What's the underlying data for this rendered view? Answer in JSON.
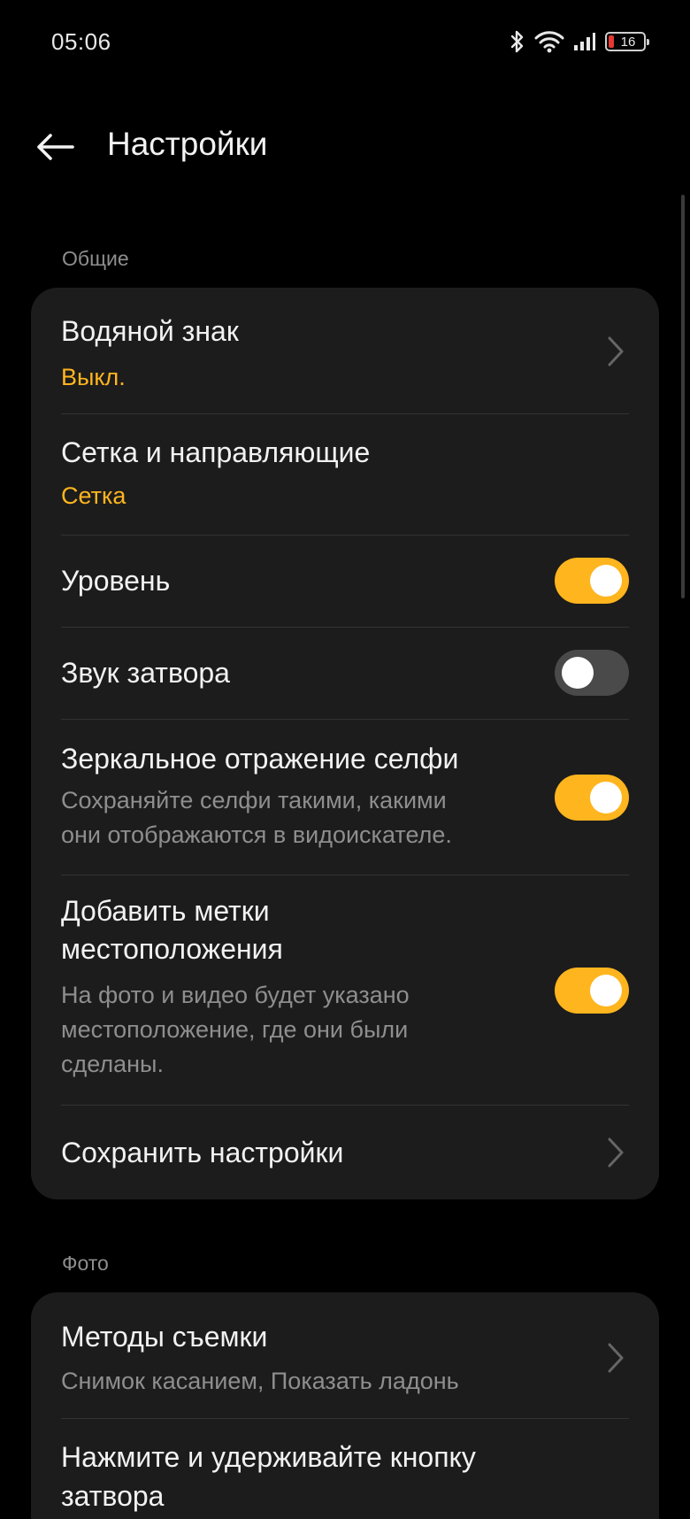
{
  "status_bar": {
    "time": "05:06",
    "battery": "16",
    "icons": [
      "bluetooth-icon",
      "wifi-icon",
      "signal-icon",
      "battery-icon"
    ]
  },
  "header": {
    "title": "Настройки",
    "back_icon": "arrow-left-icon"
  },
  "sections": {
    "general": {
      "label": "Общие",
      "items": [
        {
          "title": "Водяной знак",
          "value": "Выкл.",
          "control": "chevron"
        },
        {
          "title": "Сетка и направляющие",
          "value": "Сетка",
          "control": "none"
        },
        {
          "title": "Уровень",
          "control": "toggle",
          "state": "on"
        },
        {
          "title": "Звук затвора",
          "control": "toggle",
          "state": "off"
        },
        {
          "title": "Зеркальное отражение селфи",
          "description_line1": "Сохраняйте селфи такими, какими",
          "description_line2": "они отображаются в видоискателе.",
          "control": "toggle",
          "state": "on"
        },
        {
          "title_line1": "Добавить метки",
          "title_line2": "местоположения",
          "description_line1": "На фото и видео будет указано",
          "description_line2": "местоположение, где они были",
          "description_line3": "сделаны.",
          "control": "toggle",
          "state": "on"
        },
        {
          "title": "Сохранить настройки",
          "control": "chevron"
        }
      ]
    },
    "photo": {
      "label": "Фото",
      "items": [
        {
          "title": "Методы съемки",
          "value": "Снимок касанием, Показать ладонь",
          "control": "chevron"
        },
        {
          "title_line1": "Нажмите и удерживайте кнопку",
          "title_line2": "затвора"
        }
      ]
    }
  },
  "colors": {
    "accent": "#ffb51e",
    "background": "#000000",
    "card": "#1c1c1c",
    "secondary_text": "#8e8e8e"
  }
}
